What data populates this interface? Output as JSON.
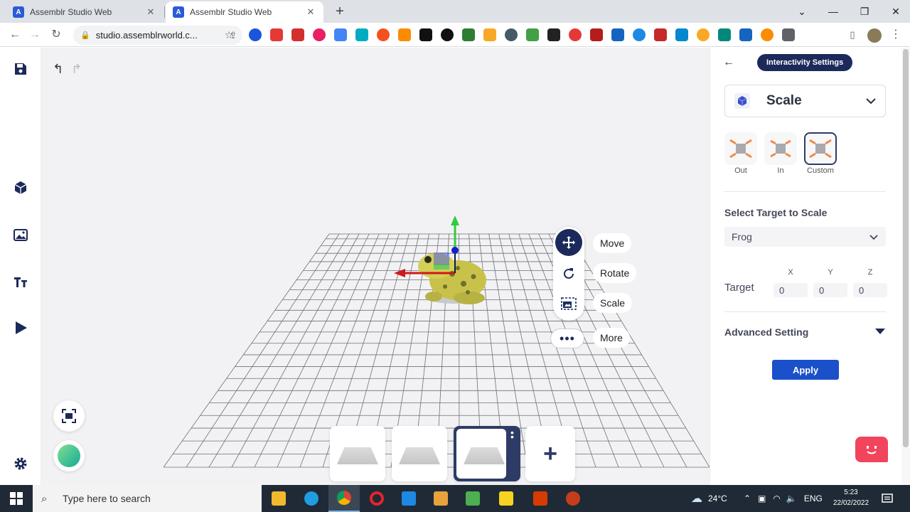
{
  "browser": {
    "tabs": [
      {
        "title": "Assemblr Studio Web",
        "active": false
      },
      {
        "title": "Assemblr Studio Web",
        "active": true
      }
    ],
    "url": "studio.assemblrworld.c...",
    "extension_colors": [
      "#1a56db",
      "#e53935",
      "#d32f2f",
      "#e91e63",
      "#4285f4",
      "#00acc1",
      "#f4511e",
      "#fb8c00",
      "#111111",
      "#111111",
      "#2e7d32",
      "#f9a825",
      "#455a64",
      "#43a047",
      "#222222",
      "#e53935",
      "#b71c1c",
      "#1565c0",
      "#1e88e5",
      "#c62828",
      "#0288d1",
      "#f9a825",
      "#00897b",
      "#1565c0",
      "#fb8c00",
      "#5f6368"
    ]
  },
  "studio": {
    "transform_tools": [
      {
        "label": "Move",
        "icon": "move-icon",
        "active": true
      },
      {
        "label": "Rotate",
        "icon": "rotate-icon",
        "active": false
      },
      {
        "label": "Scale",
        "icon": "scale-icon",
        "active": false
      }
    ],
    "more_label": "More",
    "scene_count": 3,
    "active_scene": 3
  },
  "panel": {
    "header": "Interactivity Settings",
    "animation": "Scale",
    "options": [
      {
        "label": "Out",
        "selected": false
      },
      {
        "label": "In",
        "selected": false
      },
      {
        "label": "Custom",
        "selected": true
      }
    ],
    "select_target_title": "Select Target to Scale",
    "target_object": "Frog",
    "target_label": "Target",
    "axes": [
      "X",
      "Y",
      "Z"
    ],
    "target_values": [
      "0",
      "0",
      "0"
    ],
    "advanced_label": "Advanced Setting",
    "apply_label": "Apply"
  },
  "taskbar": {
    "search_placeholder": "Type here to search",
    "temperature": "24°C",
    "language": "ENG",
    "time": "5:23",
    "date": "22/02/2022"
  },
  "colors": {
    "navy": "#1b2a5a",
    "apply_blue": "#1a50c9",
    "chatbot": "#f2445c"
  }
}
